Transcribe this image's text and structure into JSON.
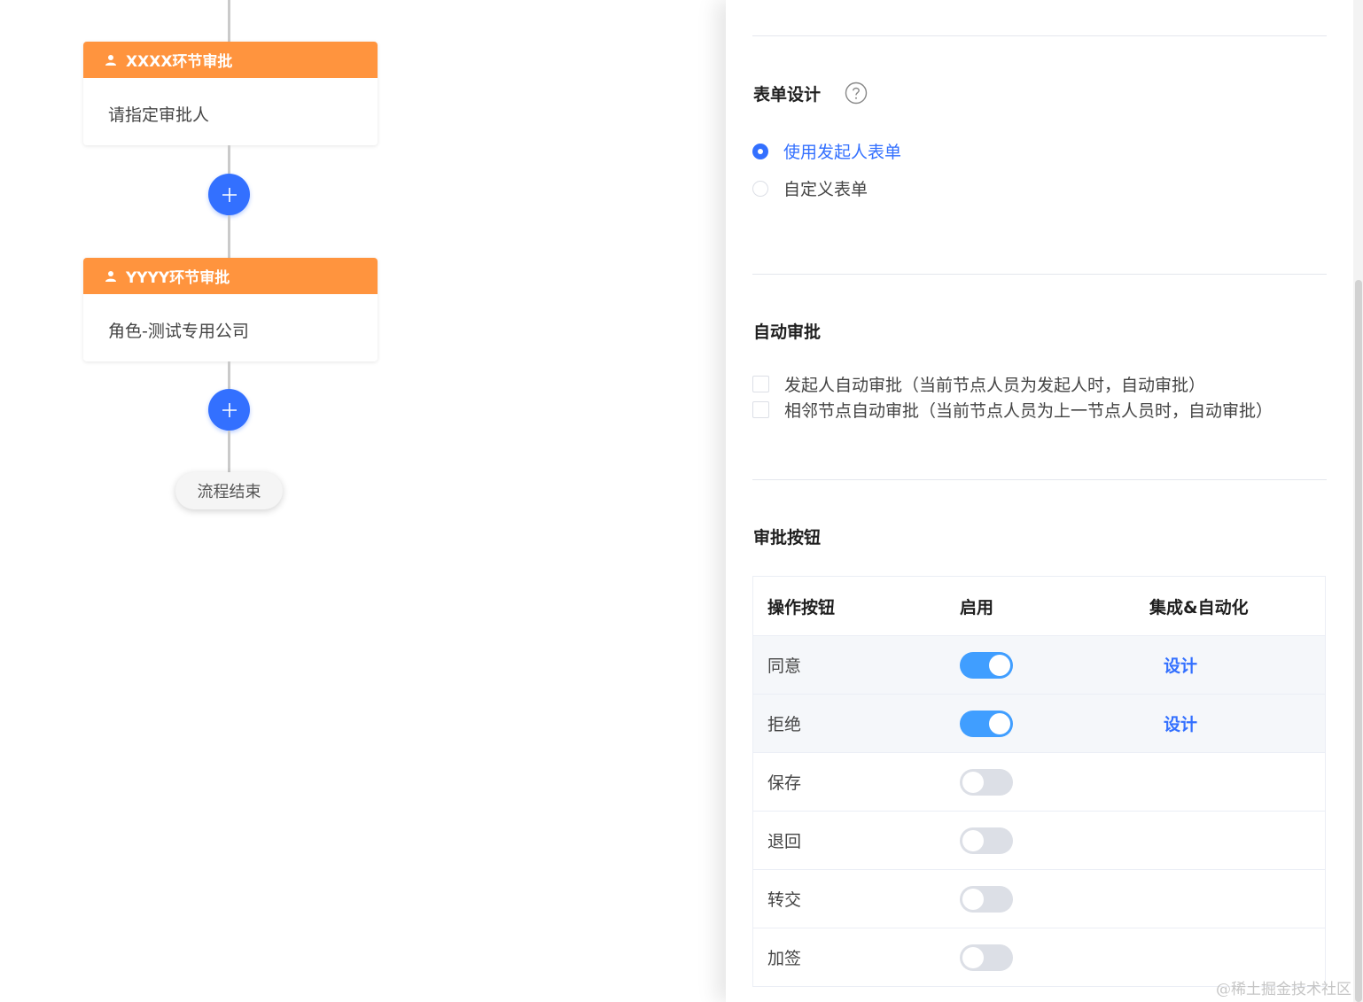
{
  "flow": {
    "nodes": [
      {
        "title": "XXXX环节审批",
        "content": "请指定审批人"
      },
      {
        "title": "YYYY环节审批",
        "content": "角色-测试专用公司"
      }
    ],
    "add_icon": "plus-icon",
    "end_label": "流程结束",
    "colors": {
      "node_header": "#ff943e",
      "add_button": "#3370ff"
    }
  },
  "drawer": {
    "form_design": {
      "title": "表单设计",
      "help_icon": "question-circle-icon",
      "options": [
        {
          "label": "使用发起人表单",
          "checked": true
        },
        {
          "label": "自定义表单",
          "checked": false
        }
      ]
    },
    "auto_approve": {
      "title": "自动审批",
      "options": [
        {
          "label": "发起人自动审批（当前节点人员为发起人时，自动审批）",
          "checked": false
        },
        {
          "label": "相邻节点自动审批（当前节点人员为上一节点人员时，自动审批）",
          "checked": false
        }
      ]
    },
    "buttons": {
      "title": "审批按钮",
      "columns": [
        "操作按钮",
        "启用",
        "集成&自动化"
      ],
      "rows": [
        {
          "name": "同意",
          "enabled": true,
          "action": "设计"
        },
        {
          "name": "拒绝",
          "enabled": true,
          "action": "设计"
        },
        {
          "name": "保存",
          "enabled": false,
          "action": ""
        },
        {
          "name": "退回",
          "enabled": false,
          "action": ""
        },
        {
          "name": "转交",
          "enabled": false,
          "action": ""
        },
        {
          "name": "加签",
          "enabled": false,
          "action": ""
        }
      ]
    },
    "colors": {
      "primary": "#3370ff",
      "switch_on": "#409eff",
      "switch_off": "#dcdfe6"
    }
  },
  "watermark": "@稀土掘金技术社区"
}
